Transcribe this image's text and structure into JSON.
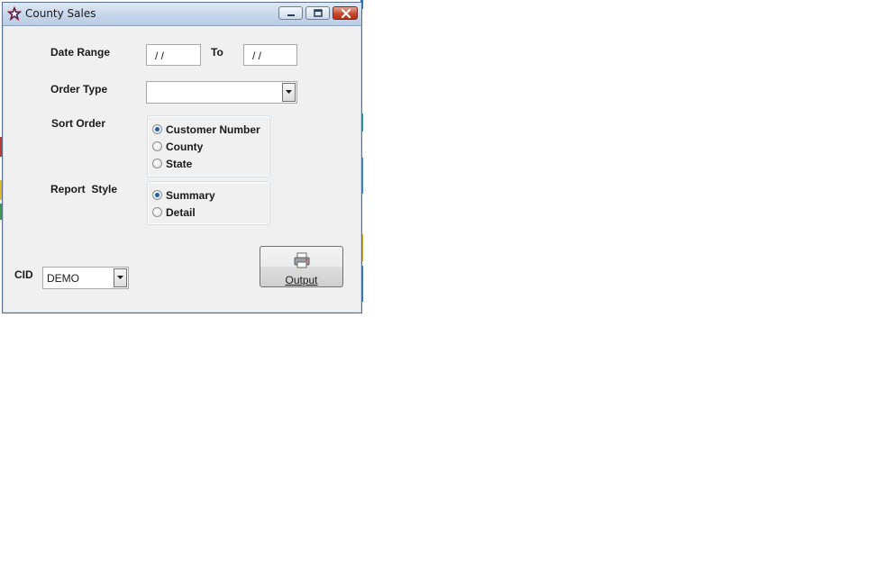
{
  "window": {
    "title": "County Sales",
    "app_icon": "star-icon",
    "controls": [
      "minimize-icon",
      "maximize-icon",
      "close-icon"
    ]
  },
  "form": {
    "date_range": {
      "label": "Date Range",
      "from_value": " / /",
      "to_label": "To",
      "to_value": " / /"
    },
    "order_type": {
      "label": "Order Type",
      "value": ""
    },
    "sort_order": {
      "label": "Sort Order",
      "options": [
        "Customer Number",
        "County",
        "State"
      ],
      "selected": "Customer Number"
    },
    "report_style": {
      "label": "Report  Style",
      "options": [
        "Summary",
        "Detail"
      ],
      "selected": "Summary"
    },
    "cid": {
      "label": "CID",
      "value": "DEMO"
    },
    "output_button": {
      "label": "Output",
      "icon": "printer-icon"
    }
  },
  "colors": {
    "titlebar": "#c8d8ec",
    "window_bg": "#f0f0f0",
    "close_button": "#c4452a",
    "radio_selected": "#1e5fa8"
  }
}
